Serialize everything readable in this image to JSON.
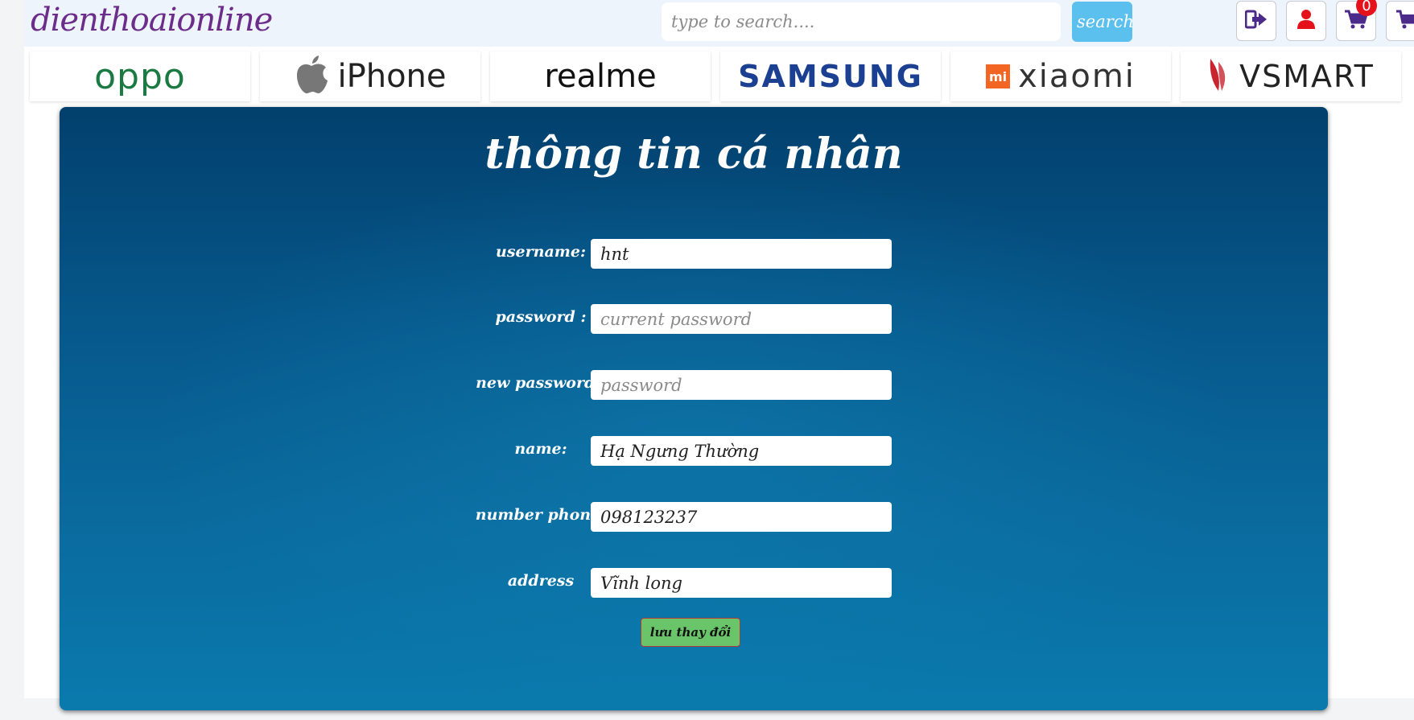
{
  "header": {
    "logo": "dienthoaionline",
    "search": {
      "placeholder": "type to search....",
      "value": ""
    },
    "search_button": "search",
    "cart_count": "0",
    "icons": [
      "sign-out-icon",
      "user-icon",
      "cart-icon",
      "cart-check-icon"
    ]
  },
  "brands": [
    {
      "name": "oppo",
      "color": "#1a7a42"
    },
    {
      "name": "iPhone",
      "color": "#222222"
    },
    {
      "name": "realme",
      "color": "#111111"
    },
    {
      "name": "SAMSUNG",
      "color": "#1b3f91"
    },
    {
      "name": "xiaomi",
      "color": "#333333",
      "badge": "mi"
    },
    {
      "name": "VSMART",
      "color": "#222222"
    }
  ],
  "form": {
    "title": "thông tin cá nhân",
    "fields": [
      {
        "label": "username:",
        "value": "hnt",
        "placeholder": ""
      },
      {
        "label": "password :",
        "value": "",
        "placeholder": "current password"
      },
      {
        "label": "new password :",
        "value": "",
        "placeholder": "password"
      },
      {
        "label": "name:",
        "value": "Hạ Ngưng Thường",
        "placeholder": ""
      },
      {
        "label": "number phone:",
        "value": "098123237",
        "placeholder": ""
      },
      {
        "label": "address",
        "value": "Vĩnh long",
        "placeholder": ""
      }
    ],
    "save_button": "lưu thay đổi"
  },
  "colors": {
    "logo": "#6b2c8a",
    "search_button": "#5bc0ee",
    "panel_top": "#02406d",
    "panel_bottom": "#0a7aad",
    "save_button": "#6ac46a",
    "badge": "#e5121c",
    "icon_purple": "#4b2a8a",
    "icon_red": "#e5121c"
  }
}
